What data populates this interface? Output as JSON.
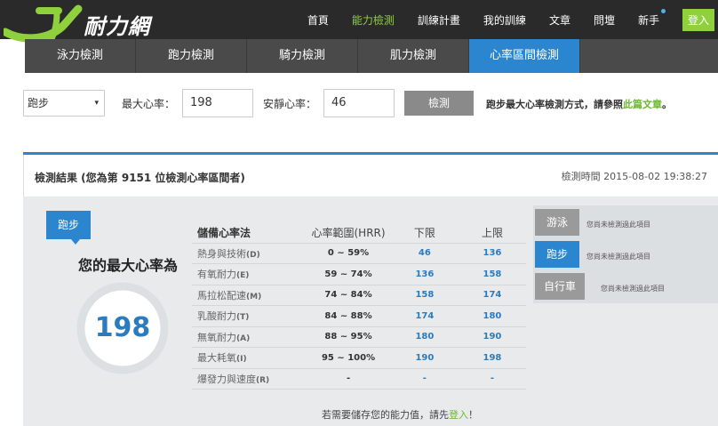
{
  "brand": {
    "logo_text": "耐力網",
    "logo_colors": {
      "swoosh": "#8ed13c",
      "text": "#ffffff"
    }
  },
  "top_nav": {
    "items": [
      "首頁",
      "能力檢測",
      "訓練計畫",
      "我的訓練",
      "文章",
      "問壇",
      "新手"
    ],
    "active": "能力檢測",
    "login": "登入"
  },
  "tabs": {
    "items": [
      "泳力檢測",
      "跑力檢測",
      "騎力檢測",
      "肌力檢測",
      "心率區間檢測"
    ],
    "active": "心率區間檢測"
  },
  "form": {
    "sport_value": "跑步",
    "max_hr_label": "最大心率：",
    "max_hr_value": "198",
    "rest_hr_label": "安靜心率：",
    "rest_hr_value": "46",
    "test_button": "檢測",
    "hint_prefix": "跑步最大心率檢測方式，請參照",
    "hint_link": "此篇文章",
    "hint_suffix": "。"
  },
  "result": {
    "title": "檢測結果 (您為第 9151 位檢測心率區間者)",
    "time": "檢測時間 2015-08-02 19:38:27",
    "sport_badge": "跑步",
    "max_hr_title": "您的最大心率為",
    "max_hr_value": "198",
    "table": {
      "headers": [
        "儲備心率法",
        "心率範圍(HRR)",
        "下限",
        "上限"
      ],
      "rows": [
        {
          "name": "熱身與技術",
          "code": "(D)",
          "range": "0 ~ 59%",
          "low": "46",
          "high": "136"
        },
        {
          "name": "有氧耐力",
          "code": "(E)",
          "range": "59 ~ 74%",
          "low": "136",
          "high": "158"
        },
        {
          "name": "馬拉松配速",
          "code": "(M)",
          "range": "74 ~ 84%",
          "low": "158",
          "high": "174"
        },
        {
          "name": "乳酸耐力",
          "code": "(T)",
          "range": "84 ~ 88%",
          "low": "174",
          "high": "180"
        },
        {
          "name": "無氧耐力",
          "code": "(A)",
          "range": "88 ~ 95%",
          "low": "180",
          "high": "190"
        },
        {
          "name": "最大耗氧",
          "code": "(I)",
          "range": "95 ~ 100%",
          "low": "190",
          "high": "198"
        },
        {
          "name": "爆發力與速度",
          "code": "(R)",
          "range": "-",
          "low": "-",
          "high": "-"
        }
      ]
    },
    "save_note_prefix": "若需要儲存您的能力值，請先",
    "save_note_link": "登入",
    "save_note_suffix": "！",
    "side": [
      {
        "label": "游泳",
        "note": "您尚未檢測過此項目",
        "active": false
      },
      {
        "label": "跑步",
        "note": "您尚未檢測過此項目",
        "active": true
      },
      {
        "label": "自行車",
        "note": "您尚未檢測過此項目",
        "active": false
      }
    ]
  },
  "colors": {
    "accent": "#2b86cf",
    "green": "#8ed13c",
    "nav_bg": "#2a2a2a",
    "tabs_bg": "#4a4a4a"
  }
}
